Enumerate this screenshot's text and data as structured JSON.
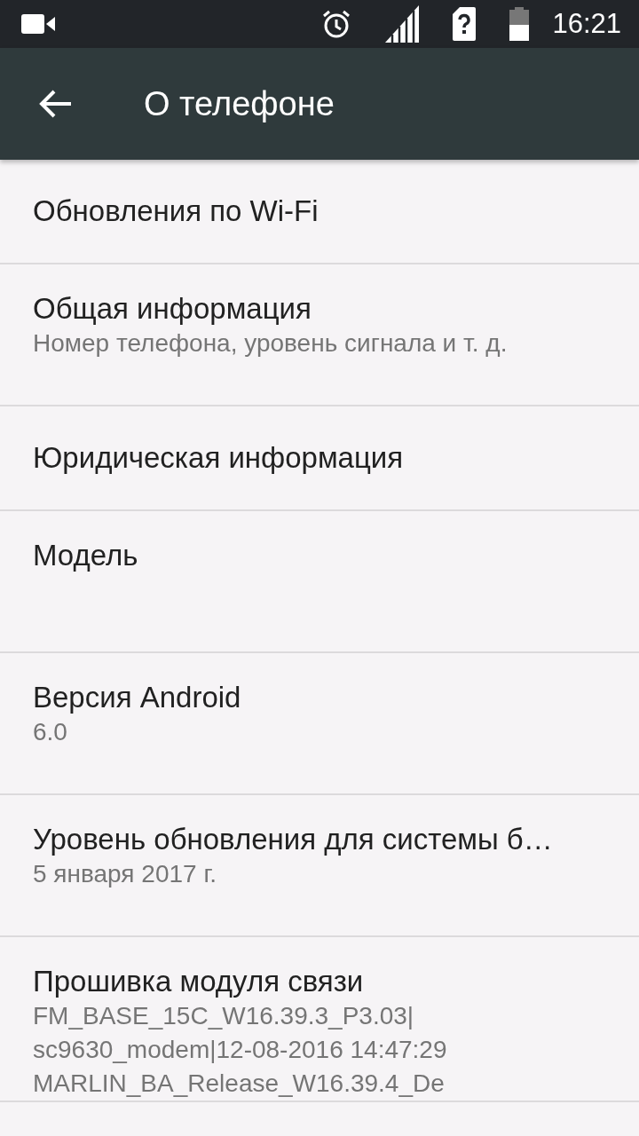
{
  "status_bar": {
    "time": "16:21"
  },
  "toolbar": {
    "title": "О телефоне"
  },
  "items": [
    {
      "kind": "single",
      "title": "Обновления по Wi-Fi"
    },
    {
      "kind": "double",
      "title": "Общая информация",
      "summary": [
        "Номер телефона, уровень сигнала и т. д."
      ]
    },
    {
      "kind": "single",
      "title": "Юридическая информация"
    },
    {
      "kind": "double",
      "title": "Модель"
    },
    {
      "kind": "double",
      "title": "Версия Android",
      "summary": [
        "6.0"
      ]
    },
    {
      "kind": "double",
      "title": "Уровень обновления для системы б…",
      "summary": [
        "5 января 2017 г."
      ]
    },
    {
      "kind": "double",
      "title": "Прошивка модуля связи",
      "summary": [
        "FM_BASE_15C_W16.39.3_P3.03|",
        "sc9630_modem|12-08-2016 14:47:29",
        "MARLIN_BA_Release_W16.39.4_De"
      ]
    }
  ]
}
